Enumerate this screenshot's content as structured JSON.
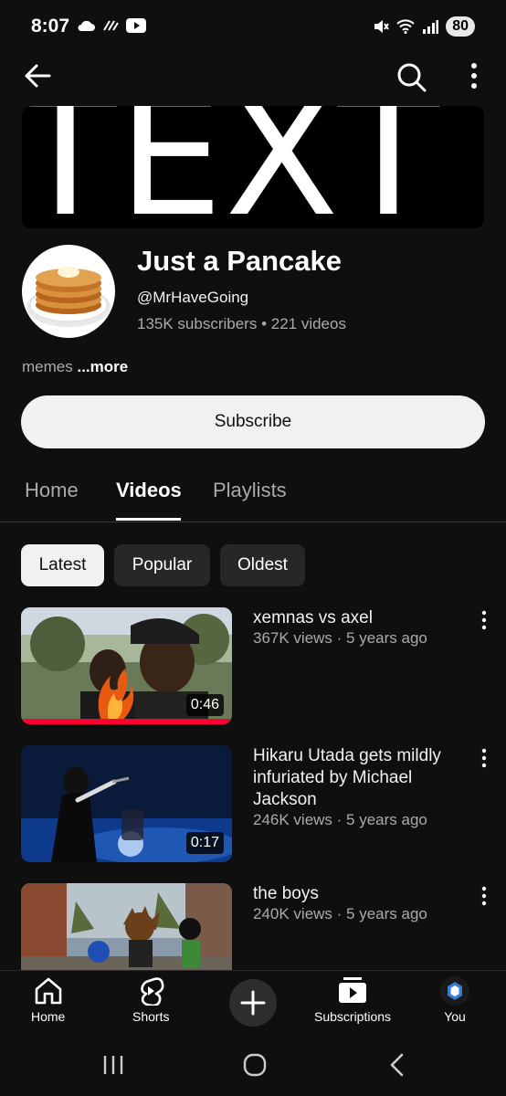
{
  "status_bar": {
    "time": "8:07",
    "battery": "80"
  },
  "channel": {
    "banner_text": "TEXT",
    "name": "Just a Pancake",
    "handle": "@MrHaveGoing",
    "stats": "135K subscribers • 221 videos",
    "description": "memes",
    "more_label": "...more",
    "subscribe_label": "Subscribe"
  },
  "tabs": [
    {
      "label": "Home",
      "active": false
    },
    {
      "label": "Videos",
      "active": true
    },
    {
      "label": "Playlists",
      "active": false
    }
  ],
  "chips": [
    {
      "label": "Latest",
      "selected": true
    },
    {
      "label": "Popular",
      "selected": false
    },
    {
      "label": "Oldest",
      "selected": false
    }
  ],
  "videos": [
    {
      "title": "xemnas vs axel",
      "meta": "367K views · 5 years ago",
      "duration": "0:46"
    },
    {
      "title": "Hikaru Utada gets mildly infuriated by Michael Jackson",
      "meta": "246K views · 5 years ago",
      "duration": "0:17"
    },
    {
      "title": "the boys",
      "meta": "240K views · 5 years ago",
      "duration": ""
    }
  ],
  "bottom_nav": {
    "home": "Home",
    "shorts": "Shorts",
    "subscriptions": "Subscriptions",
    "you": "You"
  },
  "icons": {
    "back": "back-arrow-icon",
    "search": "search-icon",
    "more": "more-vert-icon"
  },
  "colors": {
    "background": "#0f0f0f",
    "chip_bg": "#272727",
    "subscribe_bg": "#f1f1f1",
    "progress_red": "#ff0033",
    "secondary_text": "#aaaaaa"
  }
}
